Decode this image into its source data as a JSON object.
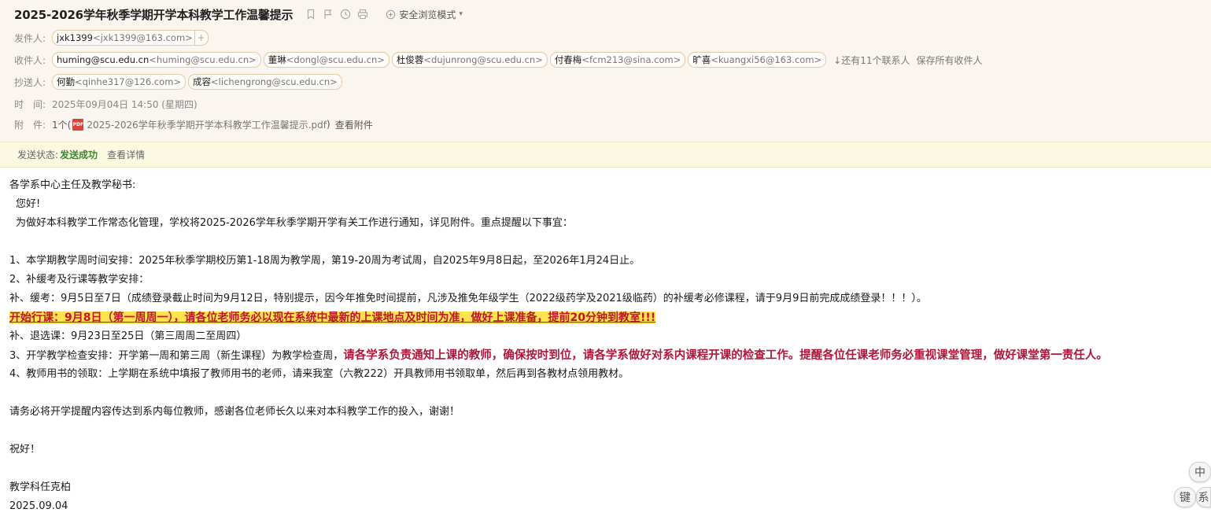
{
  "subject": "2025-2026学年秋季学期开学本科教学工作温馨提示",
  "toolbar": {
    "icons": [
      "bookmark-icon",
      "flag-icon",
      "clock-icon",
      "print-icon"
    ],
    "safe_mode_label": "安全浏览模式"
  },
  "sender": {
    "label": "发件人:",
    "chips": [
      {
        "name": "jxk1399",
        "addr": "<jxk1399@163.com>"
      }
    ]
  },
  "recipients": {
    "label": "收件人:",
    "chips": [
      {
        "name": "huming@scu.edu.cn",
        "addr": "<huming@scu.edu.cn>"
      },
      {
        "name": "董琳",
        "addr": "<dongl@scu.edu.cn>"
      },
      {
        "name": "杜俊蓉",
        "addr": "<dujunrong@scu.edu.cn>"
      },
      {
        "name": "付春梅",
        "addr": "<fcm213@sina.com>"
      },
      {
        "name": "旷喜",
        "addr": "<kuangxi56@163.com>"
      }
    ],
    "more_label": "↓还有11个联系人",
    "save_all_label": "保存所有收件人"
  },
  "cc": {
    "label": "抄送人:",
    "chips": [
      {
        "name": "何勤",
        "addr": "<qinhe317@126.com>"
      },
      {
        "name": "成容",
        "addr": "<lichengrong@scu.edu.cn>"
      }
    ]
  },
  "time": {
    "label": "时　间:",
    "value": "2025年09月04日 14:50 (星期四)"
  },
  "attachment": {
    "label": "附　件:",
    "count_prefix": "1个(",
    "filename": "2025-2026学年秋季学期开学本科教学工作温馨提示.pdf",
    "close_paren": ")",
    "view_label": "查看附件"
  },
  "status": {
    "label": "发送状态:",
    "value": "发送成功",
    "detail_label": "查看详情"
  },
  "body": {
    "greeting": "各学系中心主任及教学秘书:",
    "hello": "您好!",
    "intro": "为做好本科教学工作常态化管理，学校将2025-2026学年秋季学期开学有关工作进行通知，详见附件。重点提醒以下事宜：",
    "item1": "1、本学期教学周时间安排：2025年秋季学期校历第1-18周为教学周，第19-20周为考试周，自2025年9月8日起，至2026年1月24日止。",
    "item2": "2、补缓考及行课等教学安排：",
    "item2a": "补、缓考：9月5日至7日（成绩登录截止时间为9月12日，特别提示，因今年推免时间提前，凡涉及推免年级学生（2022级药学及2021级临药）的补缓考必修课程，请于9月9日前完成成绩登录！！！）。",
    "item2b": "开始行课：9月8日（第一周周一），请各位老师务必以现在系统中最新的上课地点及时间为准，做好上课准备，提前20分钟到教室!!!",
    "item2c": "补、退选课：9月23日至25日（第三周周二至周四）",
    "item3_prefix": "3、开学教学检查安排：开学第一周和第三周（新生课程）为教学检查周，",
    "item3_emph": "请各学系负责通知上课的教师，确保按时到位，请各学系做好对系内课程开课的检查工作。提醒各位任课老师务必重视课堂管理，做好课堂第一责任人。",
    "item4": "4、教师用书的领取：上学期在系统中填报了教师用书的老师，请来我室（六教222）开具教师用书领取单，然后再到各教材点领用教材。",
    "closing": "请务必将开学提醒内容传达到系内每位教师，感谢各位老师长久以来对本科教学工作的投入，谢谢！",
    "regards": "祝好！",
    "signature": "教学科任克柏",
    "date": "2025.09.04"
  },
  "float_buttons": [
    "中",
    "键",
    "系"
  ]
}
